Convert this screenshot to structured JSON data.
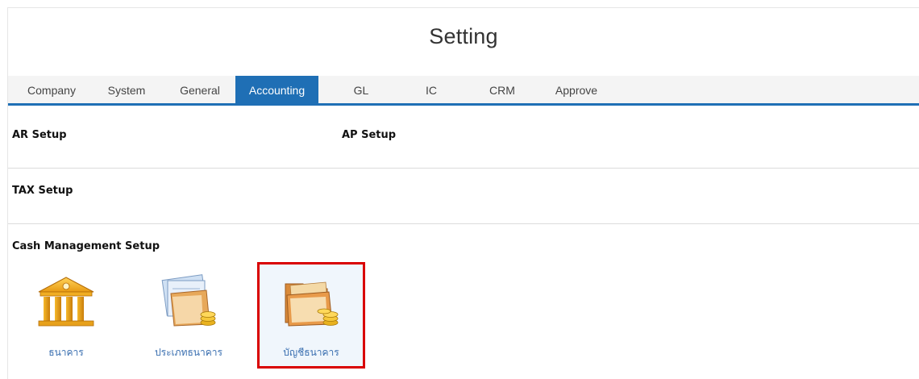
{
  "header": {
    "title": "Setting"
  },
  "tabs": [
    {
      "label": "Company"
    },
    {
      "label": "System"
    },
    {
      "label": "General"
    },
    {
      "label": "Accounting",
      "active": true
    },
    {
      "label": "GL"
    },
    {
      "label": "IC"
    },
    {
      "label": "CRM"
    },
    {
      "label": "Approve"
    }
  ],
  "sections": {
    "ar_setup": "AR Setup",
    "ap_setup": "AP Setup",
    "tax_setup": "TAX Setup",
    "cash_management_setup": "Cash Management Setup"
  },
  "cash_management_items": [
    {
      "label": "ธนาคาร",
      "icon": "bank-building-icon"
    },
    {
      "label": "ประเภทธนาคาร",
      "icon": "bank-type-folder-icon"
    },
    {
      "label": "บัญชีธนาคาร",
      "icon": "bank-account-folder-icon",
      "highlighted": true
    }
  ],
  "colors": {
    "accent": "#1f6fb5",
    "highlight_border": "#d90000",
    "link_text": "#3a6fb0"
  }
}
